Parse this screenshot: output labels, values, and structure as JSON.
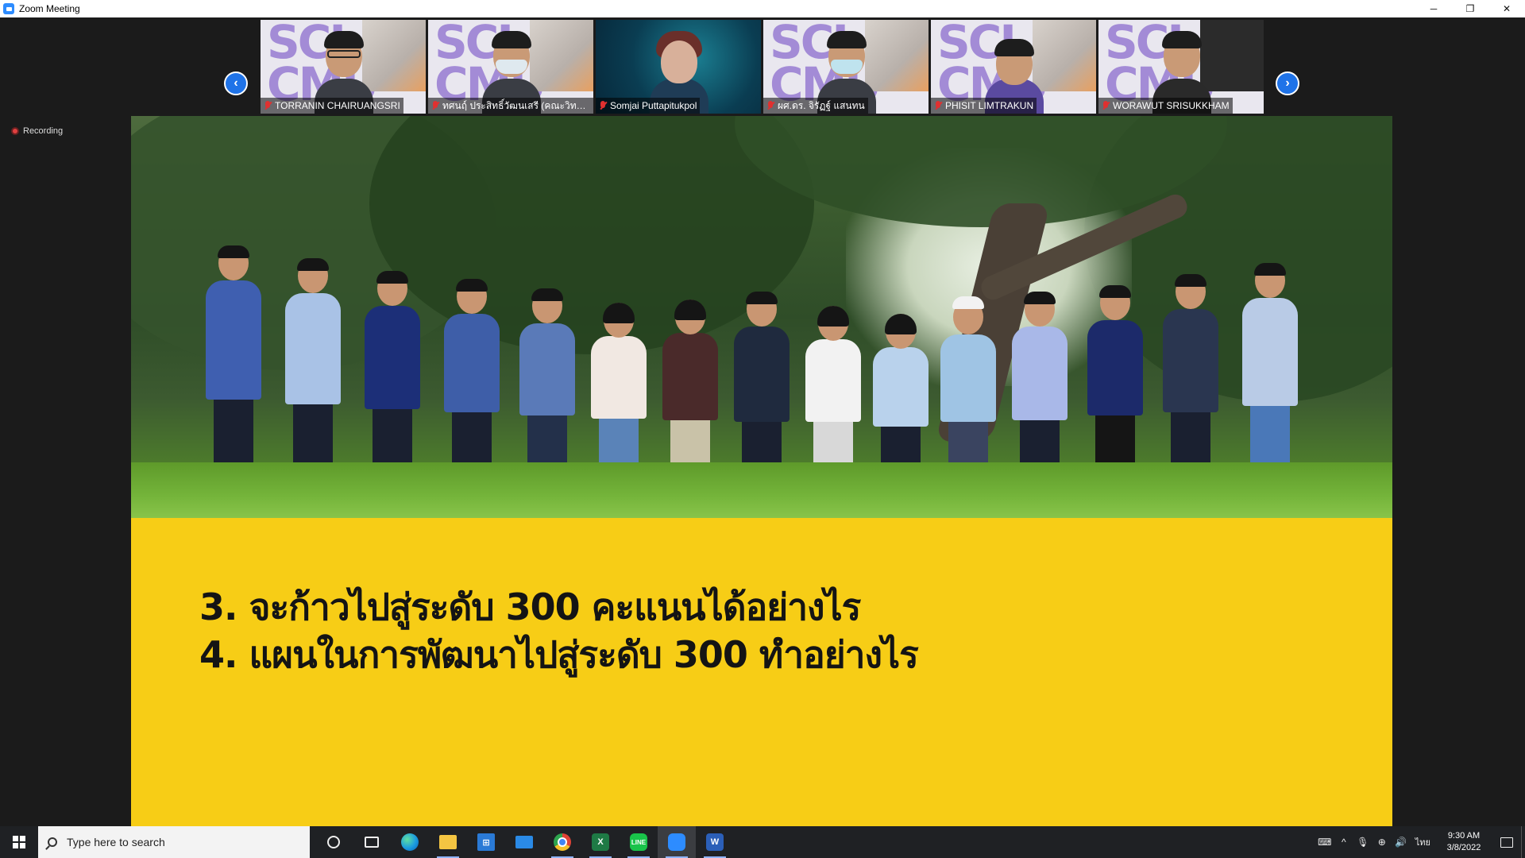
{
  "window": {
    "title": "Zoom Meeting",
    "controls": {
      "minimize": "─",
      "restore": "❐",
      "close": "✕"
    }
  },
  "gallery": {
    "prev_arrow": "‹",
    "next_arrow": "›",
    "participants": [
      {
        "name": "TORRANIN CHAIRUANGSRI",
        "muted": true,
        "background": "sci-cmu",
        "mask": false,
        "glasses": true
      },
      {
        "name": "ทศนฤ์ ประสิทธิ์วัฒนเสรี (คณะวิทยาศาส...",
        "muted": true,
        "background": "sci-cmu",
        "mask": true,
        "glasses": false
      },
      {
        "name": "Somjai Puttapitukpol",
        "muted": true,
        "background": "teal",
        "mask": false,
        "glasses": false
      },
      {
        "name": "ผศ.ดร. จิรัฏฐ์ แสนทน",
        "muted": true,
        "background": "sci-cmu",
        "mask": true,
        "glasses": false
      },
      {
        "name": "PHISIT LIMTRAKUN",
        "muted": true,
        "background": "sci-cmu",
        "mask": false,
        "glasses": false
      },
      {
        "name": "WORAWUT SRISUKKHAM",
        "muted": true,
        "background": "sci-cmu",
        "mask": false,
        "glasses": false
      }
    ],
    "background_logo": "SCI CMU"
  },
  "recording": {
    "label": "Recording"
  },
  "slide": {
    "lines": [
      "3. จะก้าวไปสู่ระดับ 300 คะแนนได้อย่างไร",
      "4. แผนในการพัฒนาไปสู่ระดับ 300 ทำอย่างไร"
    ],
    "colors": {
      "banner": "#f7cd16",
      "text": "#141414"
    }
  },
  "taskbar": {
    "search_placeholder": "Type here to search",
    "apps": [
      "cortana",
      "task-view",
      "edge",
      "file-explorer",
      "microsoft-store",
      "mail",
      "chrome",
      "excel",
      "line",
      "zoom",
      "word"
    ],
    "app_glyphs": {
      "excel": "X",
      "line": "LINE",
      "word": "W",
      "store": "⊞"
    },
    "tray": {
      "keyboard": "⌨",
      "chevron": "^",
      "mic": "🎙",
      "network": "⊕",
      "volume": "🔊",
      "language": "ไทย"
    },
    "clock": {
      "time": "9:30 AM",
      "date": "3/8/2022"
    }
  }
}
